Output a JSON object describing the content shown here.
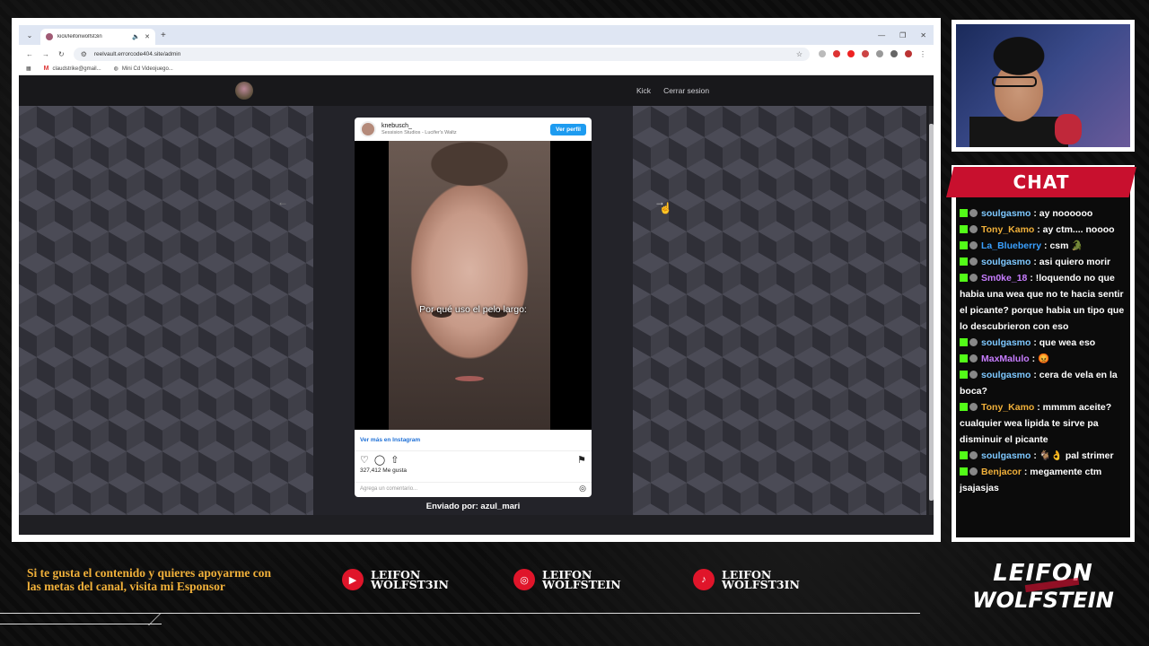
{
  "browser": {
    "tab_title": "kick/leifonwolfst3in",
    "url": "reelvault.errorcode404.site/admin",
    "bookmarks": [
      "claudstrike@gmail...",
      "Mini Cd Videojuego..."
    ]
  },
  "site": {
    "nav": [
      "Kick",
      "Cerrar sesion"
    ]
  },
  "instagram": {
    "username": "knebusch_",
    "subtitle": "Sessision Studios - Lucifer's Waltz",
    "follow_label": "Ver perfil",
    "caption": "Por qué uso el pelo largo:",
    "more_label": "Ver más en Instagram",
    "likes": "327,412 Me gusta",
    "comment_placeholder": "Agrega un comentario..."
  },
  "sent_by": "Enviado por: azul_mari",
  "chat": {
    "title": "CHAT",
    "messages": [
      {
        "user": "soulgasmo",
        "color": "#7ec8ff",
        "text": ": ay noooooo"
      },
      {
        "user": "Tony_Kamo",
        "color": "#f0b03a",
        "text": ": ay ctm.... noooo"
      },
      {
        "user": "La_Blueberry",
        "color": "#3aa0ff",
        "text": ": csm 🐊"
      },
      {
        "user": "soulgasmo",
        "color": "#7ec8ff",
        "text": ": asi quiero morir"
      },
      {
        "user": "Sm0ke_18",
        "color": "#c77dff",
        "text": ": !loquendo no que habia una wea que no te hacia sentir el picante? porque habia un tipo que lo descubrieron con eso"
      },
      {
        "user": "soulgasmo",
        "color": "#7ec8ff",
        "text": ": que wea eso"
      },
      {
        "user": "MaxMalulo",
        "color": "#c77dff",
        "text": ": 😡"
      },
      {
        "user": "soulgasmo",
        "color": "#7ec8ff",
        "text": ": cera de vela en la boca?"
      },
      {
        "user": "Tony_Kamo",
        "color": "#f0b03a",
        "text": ": mmmm aceite? cualquier wea lipida te sirve pa disminuir el picante"
      },
      {
        "user": "soulgasmo",
        "color": "#7ec8ff",
        "text": ": 🐐👌 pal strimer"
      },
      {
        "user": "Benjacor",
        "color": "#f0b03a",
        "text": ": megamente ctm jsajasjas"
      }
    ]
  },
  "footer": {
    "promo": "Si te gusta el contenido y quieres apoyarme con las metas del canal, visita mi Esponsor",
    "socials": [
      {
        "icon": "youtube-icon",
        "line1": "LEIFON",
        "line2": "WOLFST3IN"
      },
      {
        "icon": "instagram-icon",
        "line1": "LEIFON",
        "line2": "WOLFSTEIN"
      },
      {
        "icon": "tiktok-icon",
        "line1": "LEIFON",
        "line2": "WOLFST3IN"
      }
    ],
    "logo_line1": "LEIFON",
    "logo_line2": "WOLFSTEIN"
  },
  "colors": {
    "accent_red": "#c8102e",
    "footer_gold": "#f0b03a",
    "kick_green": "#53fc18"
  }
}
